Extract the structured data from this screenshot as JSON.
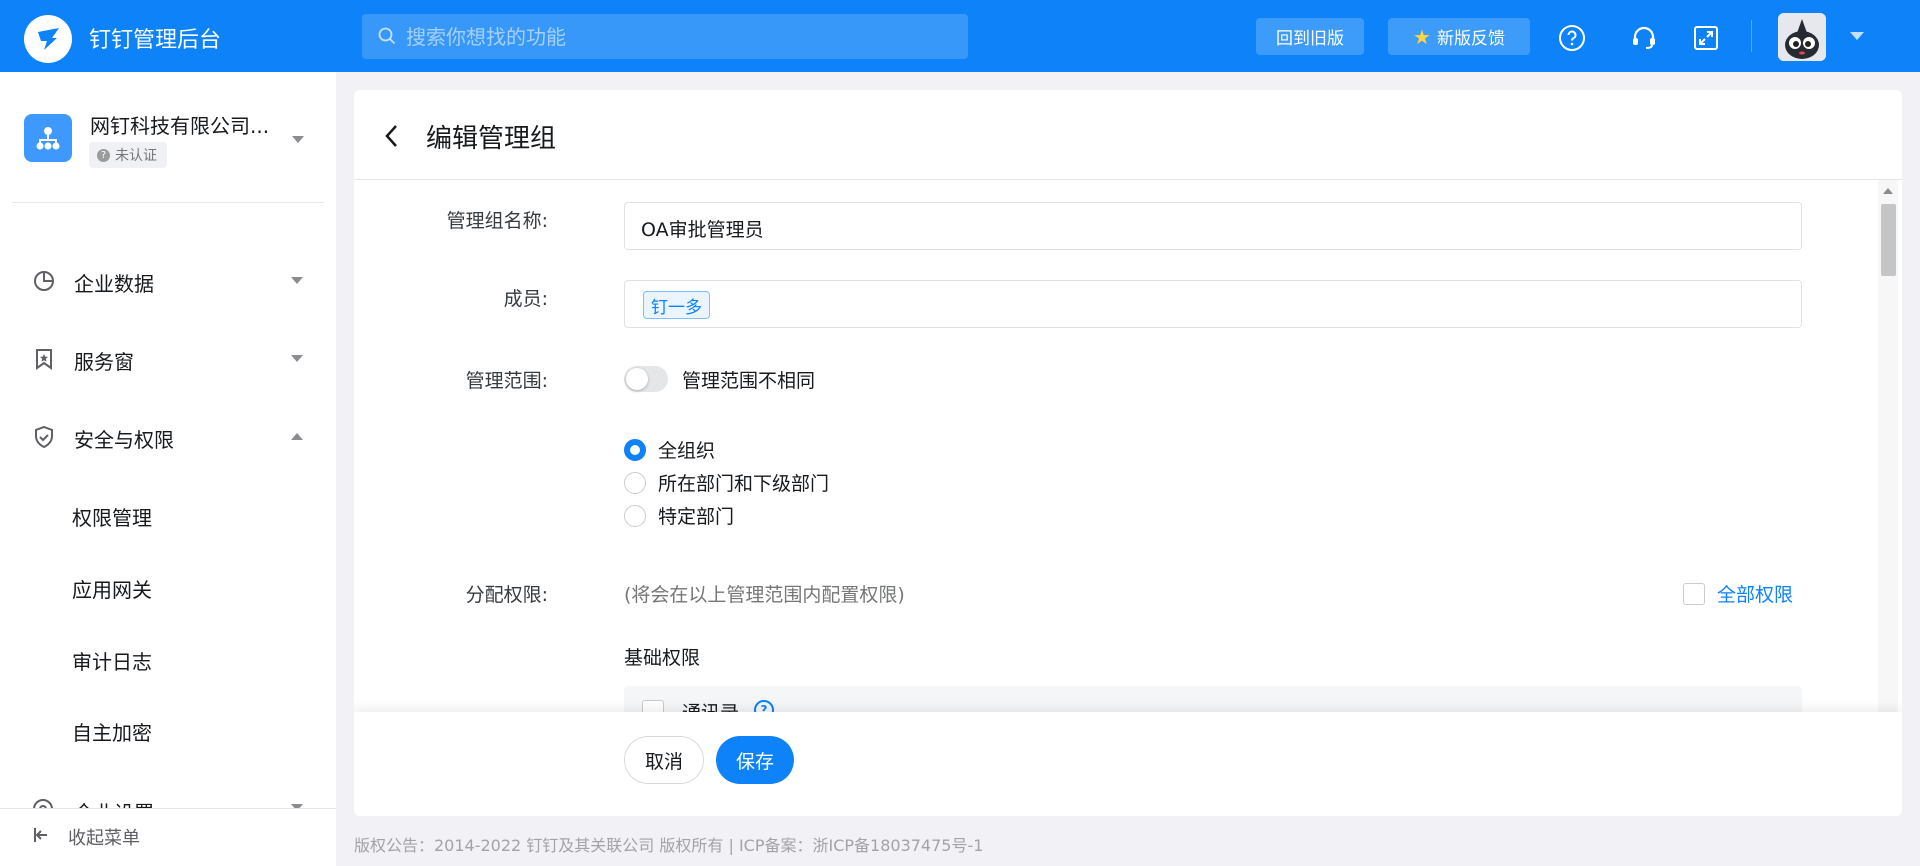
{
  "topbar": {
    "app_title": "钉钉管理后台",
    "search_placeholder": "搜索你想找的功能",
    "old_version_label": "回到旧版",
    "feedback_label": "新版反馈",
    "icons": [
      "help-icon",
      "headset-icon",
      "fullscreen-icon"
    ]
  },
  "sidebar": {
    "org_name": "网钉科技有限公司...",
    "org_status": "未认证",
    "nav": [
      {
        "label": "企业数据",
        "icon": "pie-chart-icon",
        "expanded": false
      },
      {
        "label": "服务窗",
        "icon": "bookmark-star-icon",
        "expanded": false
      },
      {
        "label": "安全与权限",
        "icon": "shield-check-icon",
        "expanded": true
      }
    ],
    "sub_items": [
      "权限管理",
      "应用网关",
      "审计日志",
      "自主加密"
    ],
    "partial_item": "企业设置",
    "collapse_label": "收起菜单"
  },
  "page": {
    "title": "编辑管理组",
    "labels": {
      "group_name": "管理组名称:",
      "members": "成员:",
      "scope": "管理范围:",
      "permissions": "分配权限:"
    },
    "group_name_value": "OA审批管理员",
    "member_tag": "钉一多",
    "scope_toggle_label": "管理范围不相同",
    "scope_toggle_on": false,
    "scope_options": [
      "全组织",
      "所在部门和下级部门",
      "特定部门"
    ],
    "scope_selected": "全组织",
    "perm_hint": "(将会在以上管理范围内配置权限)",
    "all_perm_label": "全部权限",
    "section_basic": "基础权限",
    "perm_first_row": "通讯录",
    "cancel_label": "取消",
    "save_label": "保存"
  },
  "footer": {
    "copyright": "版权公告：2014-2022 钉钉及其关联公司 版权所有 | ICP备案：浙ICP备18037475号-1"
  },
  "colors": {
    "brand": "#0d82f9",
    "sidebar_bg": "#ffffff",
    "page_bg": "#f2f2f6"
  }
}
